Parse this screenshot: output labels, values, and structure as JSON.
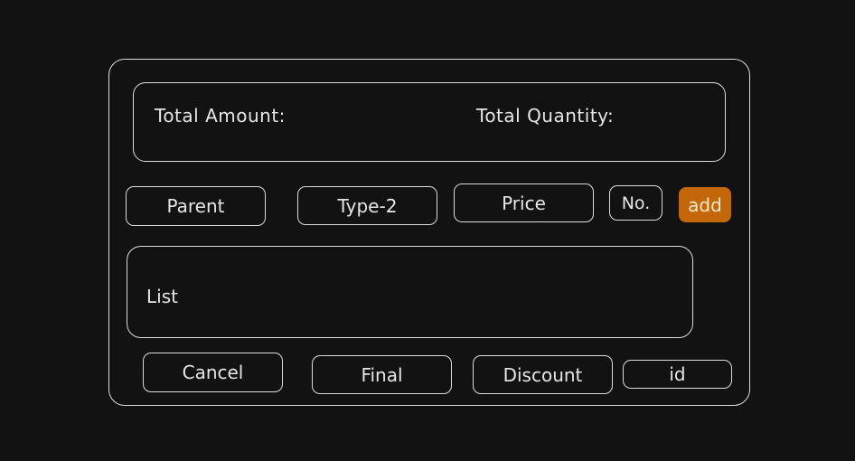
{
  "summary": {
    "total_amount_label": "Total Amount:",
    "total_quantity_label": "Total Quantity:"
  },
  "inputs": {
    "parent": "Parent",
    "type2": "Type-2",
    "price": "Price",
    "number": "No.",
    "add": "add"
  },
  "list": {
    "label": "List"
  },
  "actions": {
    "cancel": "Cancel",
    "final": "Final",
    "discount": "Discount",
    "id": "id"
  },
  "colors": {
    "background": "#121212",
    "stroke": "#dcdcdc",
    "accent": "#c4670a"
  }
}
